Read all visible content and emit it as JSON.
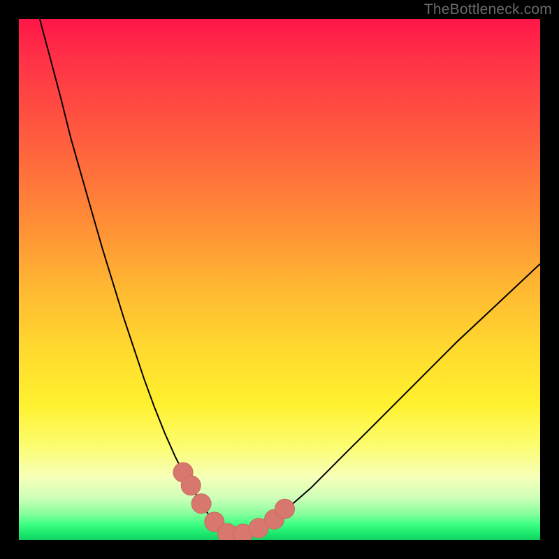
{
  "watermark": "TheBottleneck.com",
  "chart_data": {
    "type": "line",
    "title": "",
    "xlabel": "",
    "ylabel": "",
    "xlim": [
      0,
      100
    ],
    "ylim": [
      0,
      100
    ],
    "grid": false,
    "series": [
      {
        "name": "bottleneck-curve",
        "x": [
          4,
          6,
          8,
          10,
          12,
          14,
          16,
          18,
          20,
          22,
          24,
          26,
          28,
          30,
          31.5,
          33,
          35,
          37,
          38.5,
          40,
          42,
          44,
          48,
          52,
          56,
          62,
          68,
          76,
          84,
          92,
          100
        ],
        "values": [
          100,
          92.5,
          85,
          77,
          70,
          63,
          56,
          49.5,
          43,
          37,
          31,
          25.5,
          20.5,
          16,
          13,
          10.5,
          7,
          4,
          2.3,
          1.3,
          1,
          1.5,
          3.5,
          6.5,
          10,
          16,
          22,
          30,
          38,
          45.5,
          53
        ]
      }
    ],
    "markers": [
      {
        "name": "pink-blob-left-upper",
        "x": 31.5,
        "y": 13
      },
      {
        "name": "pink-blob-left-lower",
        "x": 33,
        "y": 10.5
      },
      {
        "name": "pink-blob-knee-left",
        "x": 35,
        "y": 7
      },
      {
        "name": "pink-blob-knee-right",
        "x": 37.5,
        "y": 3.5
      },
      {
        "name": "pink-blob-floor-1",
        "x": 40,
        "y": 1.3
      },
      {
        "name": "pink-blob-floor-2",
        "x": 43,
        "y": 1.2
      },
      {
        "name": "pink-blob-floor-3",
        "x": 46,
        "y": 2.3
      },
      {
        "name": "pink-blob-right-lower",
        "x": 49,
        "y": 4
      },
      {
        "name": "pink-blob-right-upper",
        "x": 51,
        "y": 6
      }
    ],
    "colors": {
      "curve": "#000000",
      "marker_fill": "#d8776d",
      "marker_stroke": "#c96a60"
    }
  }
}
